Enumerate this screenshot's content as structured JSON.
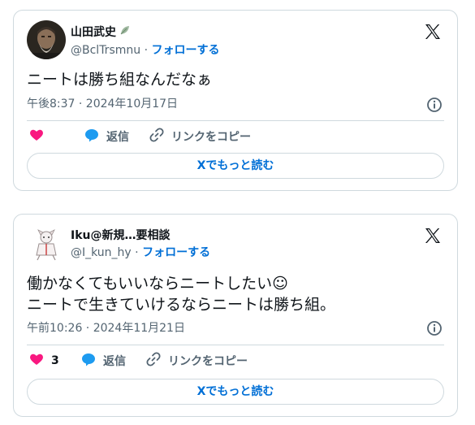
{
  "tweets": [
    {
      "display_name": "山田武史",
      "handle": "@BclTrsmnu",
      "separator": "·",
      "follow_label": "フォローする",
      "text": "ニートは勝ち組なんだなぁ",
      "timestamp": "午後8:37 · 2024年10月17日",
      "likes": "",
      "reply_label": "返信",
      "copy_link_label": "リンクをコピー",
      "read_more_label": "Xでもっと読む"
    },
    {
      "display_name": "Iku@新規…要相談",
      "handle": "@I_kun_hy",
      "separator": "·",
      "follow_label": "フォローする",
      "text": "働かなくてもいいならニートしたい☺\nニートで生きていけるならニートは勝ち組。",
      "timestamp": "午前10:26 · 2024年11月21日",
      "likes": "3",
      "reply_label": "返信",
      "copy_link_label": "リンクをコピー",
      "read_more_label": "Xでもっと読む"
    }
  ],
  "colors": {
    "like": "#f91880",
    "reply": "#1d9bf0",
    "link": "#006fd6",
    "muted": "#536471"
  },
  "icons": [
    "x-logo-icon",
    "info-icon",
    "heart-icon",
    "reply-bubble-icon",
    "link-icon",
    "leaf-icon"
  ]
}
